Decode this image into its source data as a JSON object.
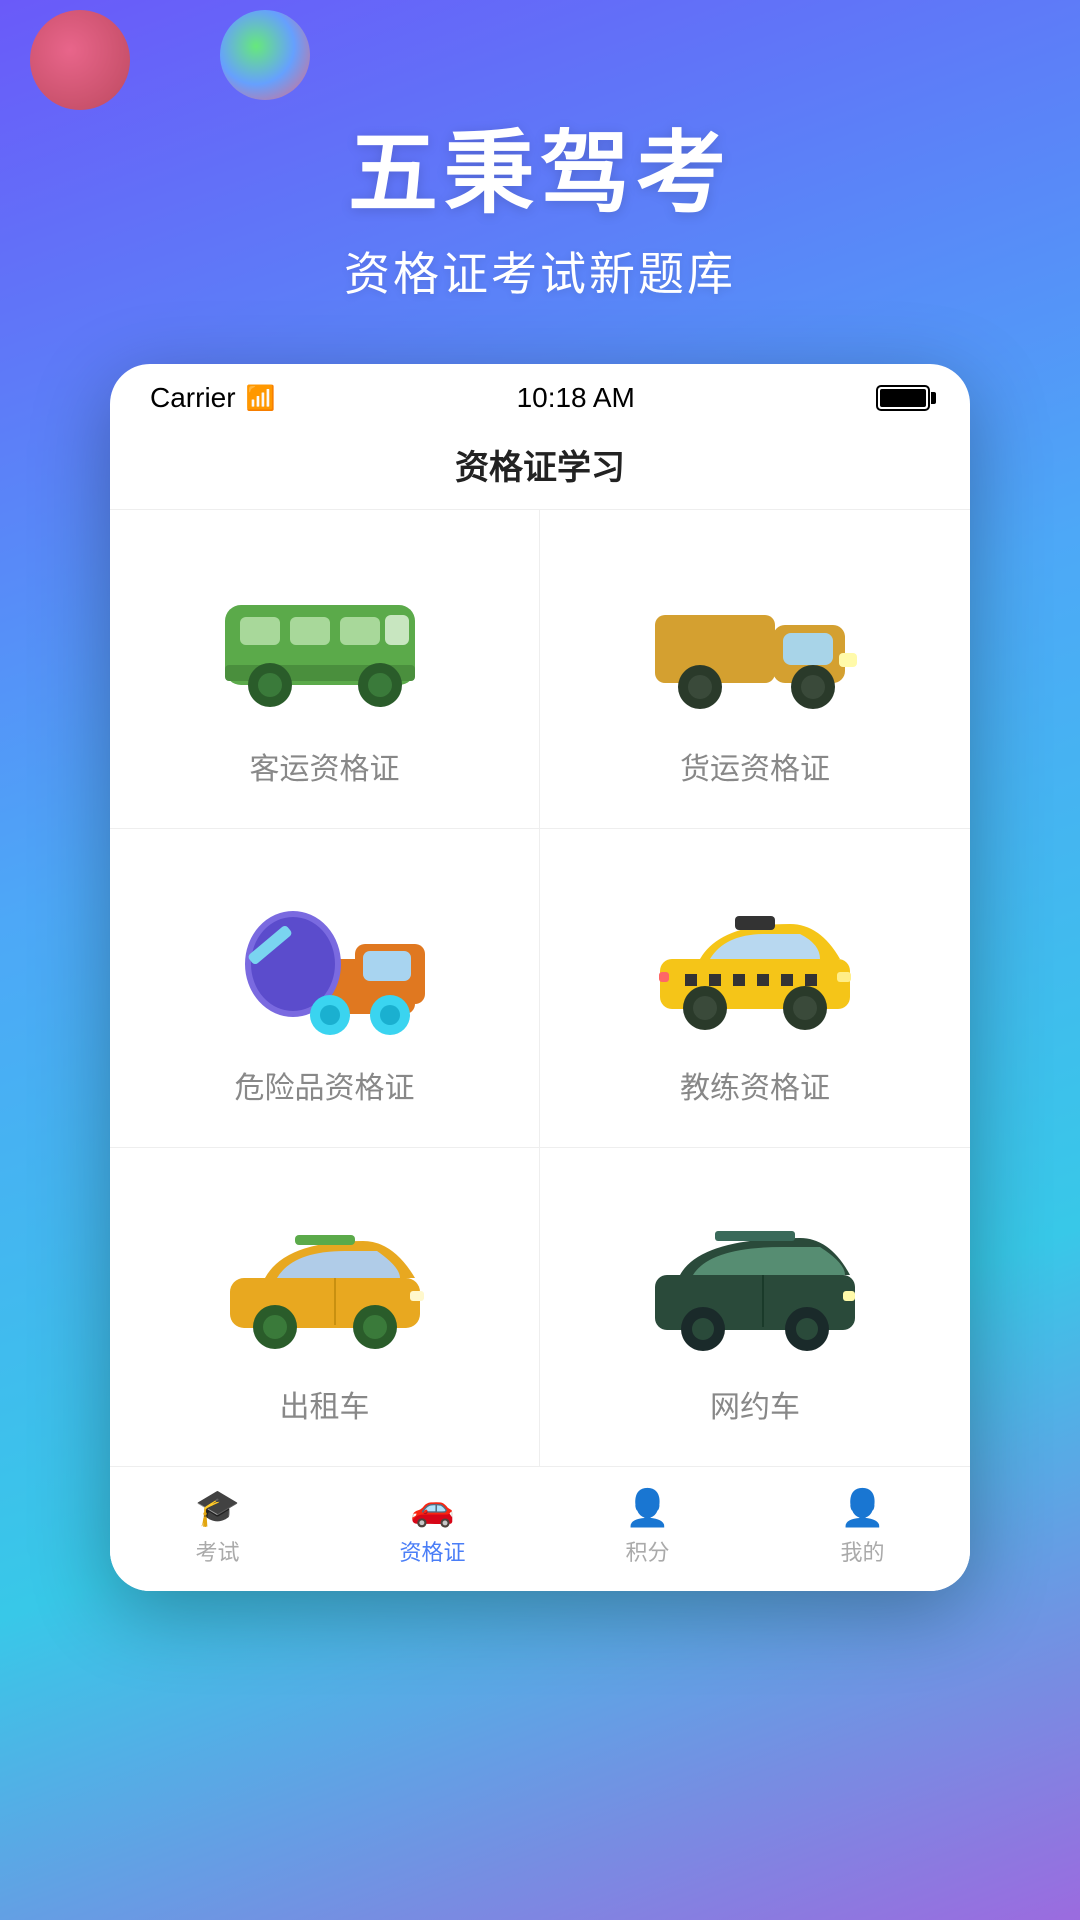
{
  "app": {
    "title": "五秉驾考",
    "subtitle": "资格证考试新题库"
  },
  "statusBar": {
    "carrier": "Carrier",
    "time": "10:18 AM"
  },
  "pageTitle": "资格证学习",
  "grid": [
    {
      "id": "passenger",
      "label": "客运资格证",
      "type": "bus"
    },
    {
      "id": "freight",
      "label": "货运资格证",
      "type": "truck"
    },
    {
      "id": "hazmat",
      "label": "危险品资格证",
      "type": "mixer"
    },
    {
      "id": "trainer",
      "label": "教练资格证",
      "type": "taxi"
    },
    {
      "id": "rental",
      "label": "出租车",
      "type": "yellow-car"
    },
    {
      "id": "rideshare",
      "label": "网约车",
      "type": "suv"
    }
  ],
  "tabBar": {
    "tabs": [
      {
        "id": "exam",
        "label": "考试",
        "active": false
      },
      {
        "id": "certificate",
        "label": "资格证",
        "active": true
      },
      {
        "id": "points",
        "label": "积分",
        "active": false
      },
      {
        "id": "mine",
        "label": "我的",
        "active": false
      }
    ]
  }
}
